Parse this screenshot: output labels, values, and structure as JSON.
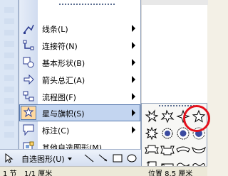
{
  "menu": {
    "items": [
      {
        "label": "线条(L)",
        "icon": "lines-icon"
      },
      {
        "label": "连接符(N)",
        "icon": "connector-icon"
      },
      {
        "label": "基本形状(B)",
        "icon": "basic-shapes-icon"
      },
      {
        "label": "箭头总汇(A)",
        "icon": "block-arrows-icon"
      },
      {
        "label": "流程图(F)",
        "icon": "flowchart-icon"
      },
      {
        "label": "星与旗帜(S)",
        "icon": "stars-banners-icon"
      },
      {
        "label": "标注(C)",
        "icon": "callouts-icon"
      },
      {
        "label": "其他自选图形(M)...",
        "icon": "more-autoshapes-icon"
      }
    ]
  },
  "toolbar": {
    "autoshape_label": "自选图形(U)"
  },
  "status": {
    "left": "1 节",
    "middle": "1/1 厘米",
    "right": "位置 8.5 厘米"
  },
  "colors": {
    "active_bg": "#c3d5f0",
    "highlight_ring": "#e5101b",
    "menu_border": "#8e9fb9"
  }
}
